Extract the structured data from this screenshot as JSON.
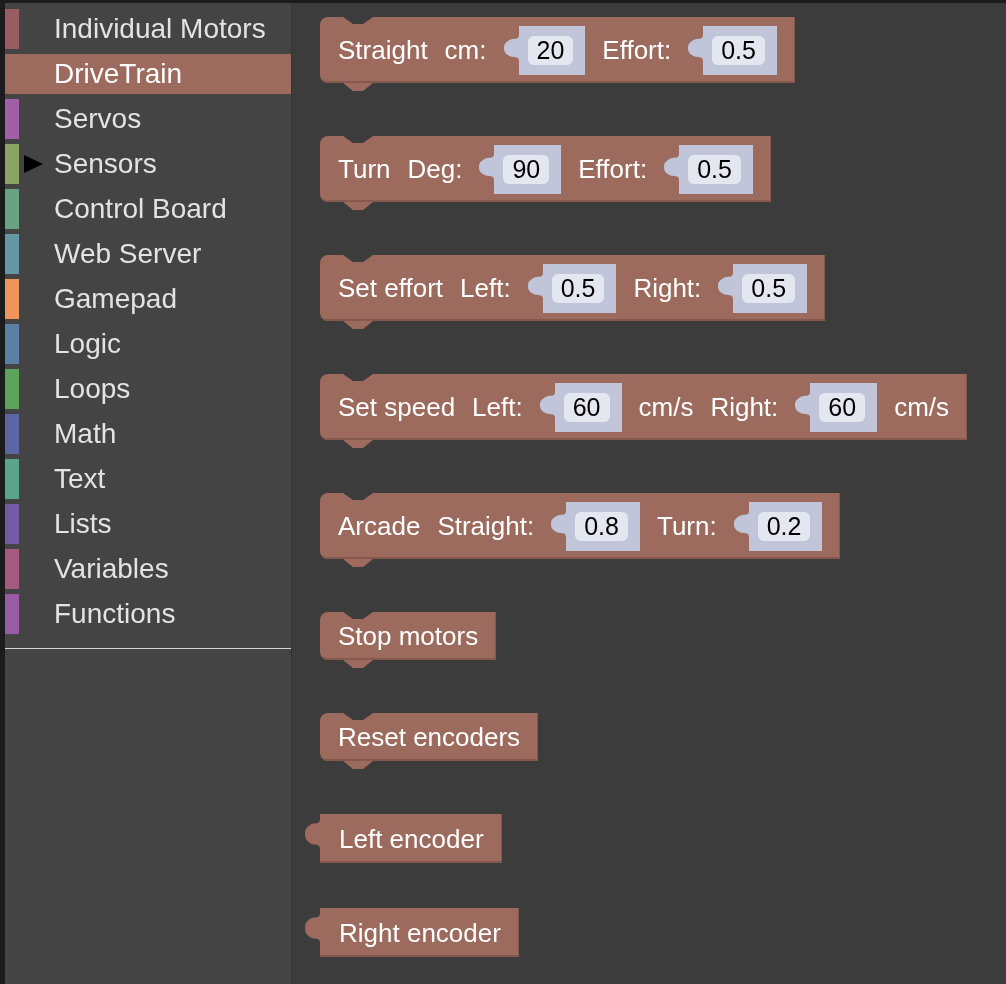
{
  "toolbox": {
    "categories": [
      {
        "kind": "category",
        "label": "Individual Motors",
        "color": "#9a5c63",
        "selected": false
      },
      {
        "kind": "category",
        "label": "DriveTrain",
        "color": "#9c6b5e",
        "selected": true
      },
      {
        "kind": "category",
        "label": "Servos",
        "color": "#a25fa6",
        "selected": false
      },
      {
        "kind": "folder",
        "label": "Sensors",
        "color": "#8ca462",
        "selected": false,
        "expanded": false
      },
      {
        "kind": "category",
        "label": "Control Board",
        "color": "#6aa383",
        "selected": false
      },
      {
        "kind": "category",
        "label": "Web Server",
        "color": "#6598a5",
        "selected": false
      },
      {
        "kind": "category",
        "label": "Gamepad",
        "color": "#f0955a",
        "selected": false
      },
      {
        "kind": "category",
        "label": "Logic",
        "color": "#5b80a5",
        "selected": false
      },
      {
        "kind": "category",
        "label": "Loops",
        "color": "#5ba55b",
        "selected": false
      },
      {
        "kind": "category",
        "label": "Math",
        "color": "#5b67a5",
        "selected": false
      },
      {
        "kind": "category",
        "label": "Text",
        "color": "#5ba58c",
        "selected": false
      },
      {
        "kind": "category",
        "label": "Lists",
        "color": "#745ba5",
        "selected": false
      },
      {
        "kind": "category",
        "label": "Variables",
        "color": "#a55b80",
        "selected": false
      },
      {
        "kind": "category",
        "label": "Functions",
        "color": "#995ba5",
        "selected": false
      }
    ]
  },
  "workspace": {
    "blocks": [
      {
        "kind": "statement",
        "parts": [
          {
            "kind": "label",
            "text": "Straight"
          },
          {
            "kind": "label",
            "text": "cm:"
          },
          {
            "kind": "number",
            "value": "20"
          },
          {
            "kind": "label",
            "text": "Effort:"
          },
          {
            "kind": "number",
            "value": "0.5"
          }
        ]
      },
      {
        "kind": "statement",
        "parts": [
          {
            "kind": "label",
            "text": "Turn"
          },
          {
            "kind": "label",
            "text": "Deg:"
          },
          {
            "kind": "number",
            "value": "90"
          },
          {
            "kind": "label",
            "text": "Effort:"
          },
          {
            "kind": "number",
            "value": "0.5"
          }
        ]
      },
      {
        "kind": "statement",
        "parts": [
          {
            "kind": "label",
            "text": "Set effort"
          },
          {
            "kind": "label",
            "text": "Left:"
          },
          {
            "kind": "number",
            "value": "0.5"
          },
          {
            "kind": "label",
            "text": "Right:"
          },
          {
            "kind": "number",
            "value": "0.5"
          }
        ]
      },
      {
        "kind": "statement",
        "parts": [
          {
            "kind": "label",
            "text": "Set speed"
          },
          {
            "kind": "label",
            "text": "Left:"
          },
          {
            "kind": "number",
            "value": "60"
          },
          {
            "kind": "label",
            "text": "cm/s"
          },
          {
            "kind": "label",
            "text": "Right:"
          },
          {
            "kind": "number",
            "value": "60"
          },
          {
            "kind": "label",
            "text": "cm/s"
          }
        ]
      },
      {
        "kind": "statement",
        "parts": [
          {
            "kind": "label",
            "text": "Arcade"
          },
          {
            "kind": "label",
            "text": "Straight:"
          },
          {
            "kind": "number",
            "value": "0.8"
          },
          {
            "kind": "label",
            "text": "Turn:"
          },
          {
            "kind": "number",
            "value": "0.2"
          }
        ]
      },
      {
        "kind": "statement",
        "parts": [
          {
            "kind": "label",
            "text": "Stop motors"
          }
        ]
      },
      {
        "kind": "statement",
        "parts": [
          {
            "kind": "label",
            "text": "Reset encoders"
          }
        ]
      },
      {
        "kind": "reporter",
        "parts": [
          {
            "kind": "label",
            "text": "Left encoder"
          }
        ]
      },
      {
        "kind": "reporter",
        "parts": [
          {
            "kind": "label",
            "text": "Right encoder"
          }
        ]
      }
    ]
  }
}
